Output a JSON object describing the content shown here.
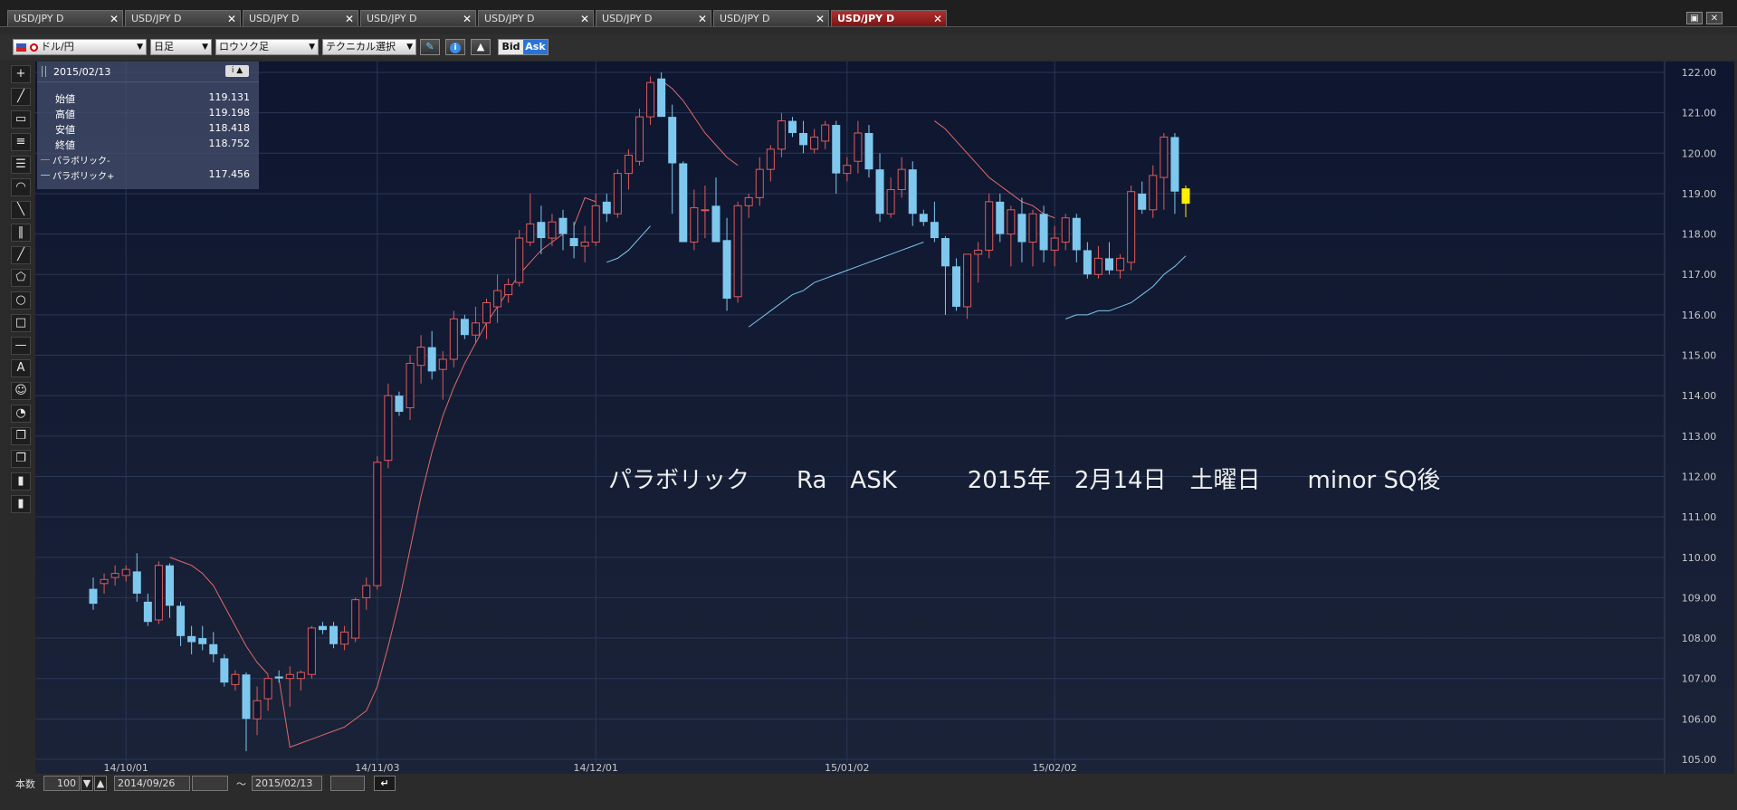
{
  "tabs": [
    {
      "label": "USD/JPY D",
      "active": false
    },
    {
      "label": "USD/JPY D",
      "active": false
    },
    {
      "label": "USD/JPY D",
      "active": false
    },
    {
      "label": "USD/JPY D",
      "active": false
    },
    {
      "label": "USD/JPY D",
      "active": false
    },
    {
      "label": "USD/JPY D",
      "active": false
    },
    {
      "label": "USD/JPY D",
      "active": false
    },
    {
      "label": "USD/JPY D",
      "active": true
    }
  ],
  "toolbar": {
    "currency_pair": "ドル/円",
    "timeframe": "日足",
    "chart_type": "ロウソク足",
    "technical_select": "テクニカル選択",
    "bid_label": "Bid",
    "ask_label": "Ask"
  },
  "info_panel": {
    "date": "2015/02/13",
    "rows": [
      {
        "label": "始値",
        "value": "119.131"
      },
      {
        "label": "高値",
        "value": "119.198"
      },
      {
        "label": "安値",
        "value": "118.418"
      },
      {
        "label": "終値",
        "value": "118.752"
      },
      {
        "label": "パラボリック-",
        "value": ""
      },
      {
        "label": "パラボリック+",
        "value": "117.456"
      }
    ]
  },
  "annotation": "パラボリック　　Ra　ASK　　　2015年　2月14日　土曜日　　minor SQ後",
  "bottom": {
    "count_label": "本数",
    "count_value": "100",
    "from_date": "2014/09/26",
    "separator": "～",
    "to_date": "2015/02/13"
  },
  "colors": {
    "background": "#101a33",
    "grid": "#2a3755",
    "up_candle": "#e05a5a",
    "down_candle": "#7ec8ee",
    "parabolic": "#e06a6a",
    "current_candle": "#ffee00",
    "active_tab": "#a02020"
  },
  "chart_data": {
    "type": "candlestick",
    "title": "",
    "ylim": [
      105,
      122
    ],
    "y_ticks": [
      "105.00",
      "106.00",
      "107.00",
      "108.00",
      "109.00",
      "110.00",
      "111.00",
      "112.00",
      "113.00",
      "114.00",
      "115.00",
      "116.00",
      "117.00",
      "118.00",
      "119.00",
      "120.00",
      "121.00",
      "122.00"
    ],
    "x_ticks": [
      {
        "label": "14/10/01",
        "index": 3
      },
      {
        "label": "14/11/03",
        "index": 26
      },
      {
        "label": "14/12/01",
        "index": 46
      },
      {
        "label": "15/01/02",
        "index": 69
      },
      {
        "label": "15/02/02",
        "index": 88
      }
    ],
    "candles": [
      [
        109.22,
        109.5,
        108.7,
        108.85
      ],
      [
        109.35,
        109.6,
        109.1,
        109.45
      ],
      [
        109.5,
        109.8,
        109.3,
        109.6
      ],
      [
        109.55,
        109.8,
        109.4,
        109.7
      ],
      [
        109.65,
        110.1,
        108.9,
        109.1
      ],
      [
        108.9,
        109.1,
        108.3,
        108.4
      ],
      [
        108.45,
        109.9,
        108.35,
        109.8
      ],
      [
        109.8,
        109.85,
        108.5,
        108.8
      ],
      [
        108.8,
        108.9,
        107.8,
        108.05
      ],
      [
        108.05,
        108.3,
        107.6,
        107.9
      ],
      [
        108.0,
        108.3,
        107.7,
        107.85
      ],
      [
        107.85,
        108.15,
        107.4,
        107.6
      ],
      [
        107.5,
        107.6,
        106.8,
        106.9
      ],
      [
        106.85,
        107.2,
        106.7,
        107.1
      ],
      [
        107.1,
        107.15,
        105.2,
        106.0
      ],
      [
        106.0,
        106.8,
        105.6,
        106.45
      ],
      [
        106.5,
        107.1,
        106.2,
        107.0
      ],
      [
        107.05,
        107.2,
        106.9,
        107.0
      ],
      [
        107.0,
        107.3,
        106.3,
        107.1
      ],
      [
        107.0,
        107.2,
        106.7,
        107.15
      ],
      [
        107.1,
        108.3,
        107.0,
        108.25
      ],
      [
        108.3,
        108.4,
        108.1,
        108.2
      ],
      [
        108.3,
        108.4,
        107.75,
        107.85
      ],
      [
        107.85,
        108.3,
        107.7,
        108.15
      ],
      [
        108.0,
        109.0,
        107.9,
        108.95
      ],
      [
        109.0,
        109.5,
        108.7,
        109.3
      ],
      [
        109.3,
        112.5,
        109.2,
        112.35
      ],
      [
        112.4,
        114.3,
        112.2,
        114.0
      ],
      [
        114.0,
        114.1,
        113.5,
        113.6
      ],
      [
        113.7,
        115.0,
        113.4,
        114.8
      ],
      [
        114.75,
        115.5,
        114.3,
        115.2
      ],
      [
        115.2,
        115.6,
        114.4,
        114.6
      ],
      [
        114.65,
        115.1,
        113.9,
        114.9
      ],
      [
        114.9,
        116.1,
        114.7,
        115.9
      ],
      [
        115.9,
        116.0,
        115.4,
        115.5
      ],
      [
        115.5,
        116.2,
        115.3,
        115.8
      ],
      [
        115.8,
        116.4,
        115.4,
        116.3
      ],
      [
        116.2,
        117.0,
        115.8,
        116.6
      ],
      [
        116.5,
        116.9,
        116.3,
        116.75
      ],
      [
        116.8,
        118.1,
        116.7,
        117.9
      ],
      [
        117.8,
        119.0,
        117.7,
        118.25
      ],
      [
        118.3,
        118.7,
        117.5,
        117.9
      ],
      [
        117.9,
        118.5,
        117.7,
        118.3
      ],
      [
        118.4,
        118.6,
        117.6,
        118.0
      ],
      [
        117.9,
        118.3,
        117.4,
        117.7
      ],
      [
        117.7,
        118.2,
        117.3,
        117.8
      ],
      [
        117.8,
        119.0,
        117.7,
        118.7
      ],
      [
        118.8,
        119.0,
        118.3,
        118.5
      ],
      [
        118.5,
        119.6,
        118.4,
        119.5
      ],
      [
        119.5,
        120.1,
        119.1,
        119.95
      ],
      [
        119.8,
        121.1,
        119.7,
        120.9
      ],
      [
        120.9,
        121.9,
        120.7,
        121.75
      ],
      [
        121.85,
        122.0,
        120.9,
        120.9
      ],
      [
        120.9,
        121.2,
        118.5,
        119.75
      ],
      [
        119.75,
        119.8,
        117.8,
        117.8
      ],
      [
        117.8,
        119.1,
        117.6,
        118.65
      ],
      [
        118.6,
        119.2,
        117.9,
        118.6
      ],
      [
        118.7,
        119.4,
        117.9,
        117.8
      ],
      [
        117.85,
        118.4,
        116.1,
        116.4
      ],
      [
        116.45,
        118.8,
        116.3,
        118.7
      ],
      [
        118.7,
        119.0,
        118.4,
        118.9
      ],
      [
        118.9,
        119.9,
        118.7,
        119.6
      ],
      [
        119.6,
        120.2,
        119.3,
        120.1
      ],
      [
        120.1,
        121.0,
        119.9,
        120.8
      ],
      [
        120.8,
        120.9,
        120.4,
        120.5
      ],
      [
        120.5,
        120.8,
        120.0,
        120.2
      ],
      [
        120.1,
        120.6,
        120.0,
        120.4
      ],
      [
        120.3,
        120.8,
        120.1,
        120.7
      ],
      [
        120.7,
        120.8,
        119.0,
        119.5
      ],
      [
        119.5,
        119.9,
        119.3,
        119.7
      ],
      [
        119.8,
        120.8,
        119.5,
        120.5
      ],
      [
        120.5,
        120.7,
        119.4,
        119.6
      ],
      [
        119.6,
        120.0,
        118.3,
        118.5
      ],
      [
        118.5,
        119.4,
        118.4,
        119.1
      ],
      [
        119.1,
        119.9,
        118.9,
        119.6
      ],
      [
        119.6,
        119.8,
        118.2,
        118.5
      ],
      [
        118.5,
        118.6,
        118.2,
        118.3
      ],
      [
        118.3,
        118.8,
        117.8,
        117.9
      ],
      [
        117.9,
        117.95,
        116.0,
        117.2
      ],
      [
        117.2,
        117.4,
        116.1,
        116.2
      ],
      [
        116.2,
        117.0,
        115.9,
        117.5
      ],
      [
        117.5,
        117.8,
        116.8,
        117.6
      ],
      [
        117.6,
        119.0,
        117.4,
        118.8
      ],
      [
        118.8,
        119.0,
        117.8,
        118.0
      ],
      [
        118.0,
        118.7,
        117.2,
        118.6
      ],
      [
        118.5,
        118.9,
        117.3,
        117.8
      ],
      [
        117.8,
        118.6,
        117.2,
        118.5
      ],
      [
        118.5,
        118.7,
        117.3,
        117.6
      ],
      [
        117.6,
        118.2,
        117.2,
        117.9
      ],
      [
        117.8,
        118.5,
        117.6,
        118.4
      ],
      [
        118.4,
        118.5,
        117.3,
        117.6
      ],
      [
        117.6,
        117.8,
        116.9,
        117.0
      ],
      [
        117.0,
        117.7,
        116.9,
        117.4
      ],
      [
        117.4,
        117.8,
        117.0,
        117.1
      ],
      [
        117.1,
        117.5,
        116.9,
        117.4
      ],
      [
        117.3,
        119.2,
        117.1,
        119.05
      ],
      [
        119.0,
        119.3,
        118.5,
        118.6
      ],
      [
        118.6,
        119.7,
        118.4,
        119.45
      ],
      [
        119.4,
        120.5,
        118.6,
        120.4
      ],
      [
        120.4,
        120.5,
        118.5,
        119.05
      ],
      [
        119.13,
        119.2,
        118.42,
        118.75
      ]
    ],
    "parabolic": [
      [
        4,
        108.5
      ],
      [
        5,
        108.6
      ],
      [
        6,
        108.8
      ],
      [
        7,
        110.0
      ],
      [
        8,
        109.9
      ],
      [
        9,
        109.8
      ],
      [
        10,
        109.6
      ],
      [
        11,
        109.3
      ],
      [
        12,
        108.8
      ],
      [
        13,
        108.3
      ],
      [
        14,
        107.8
      ],
      [
        15,
        107.4
      ],
      [
        16,
        107.1
      ],
      [
        17,
        107.0
      ],
      [
        18,
        105.3
      ],
      [
        19,
        105.4
      ],
      [
        20,
        105.5
      ],
      [
        21,
        105.6
      ],
      [
        22,
        105.7
      ],
      [
        23,
        105.8
      ],
      [
        24,
        106.0
      ],
      [
        25,
        106.2
      ],
      [
        26,
        106.8
      ],
      [
        27,
        107.8
      ],
      [
        28,
        108.9
      ],
      [
        29,
        110.2
      ],
      [
        30,
        111.5
      ],
      [
        31,
        112.6
      ],
      [
        32,
        113.5
      ],
      [
        33,
        114.2
      ],
      [
        34,
        114.8
      ],
      [
        35,
        115.3
      ],
      [
        36,
        115.8
      ],
      [
        37,
        116.2
      ],
      [
        38,
        116.6
      ],
      [
        39,
        117.0
      ],
      [
        40,
        117.3
      ],
      [
        41,
        117.6
      ],
      [
        42,
        117.8
      ],
      [
        43,
        118.0
      ],
      [
        44,
        118.2
      ],
      [
        45,
        118.9
      ],
      [
        46,
        118.8
      ],
      [
        47,
        117.3
      ],
      [
        48,
        117.4
      ],
      [
        49,
        117.6
      ],
      [
        50,
        117.9
      ],
      [
        51,
        118.2
      ],
      [
        52,
        121.8
      ],
      [
        53,
        121.6
      ],
      [
        54,
        121.3
      ],
      [
        55,
        120.9
      ],
      [
        56,
        120.5
      ],
      [
        57,
        120.2
      ],
      [
        58,
        119.9
      ],
      [
        59,
        119.7
      ],
      [
        60,
        115.7
      ],
      [
        61,
        115.9
      ],
      [
        62,
        116.1
      ],
      [
        63,
        116.3
      ],
      [
        64,
        116.5
      ],
      [
        65,
        116.6
      ],
      [
        66,
        116.8
      ],
      [
        67,
        116.9
      ],
      [
        68,
        117.0
      ],
      [
        69,
        117.1
      ],
      [
        70,
        117.2
      ],
      [
        71,
        117.3
      ],
      [
        72,
        117.4
      ],
      [
        73,
        117.5
      ],
      [
        74,
        117.6
      ],
      [
        75,
        117.7
      ],
      [
        76,
        117.8
      ],
      [
        77,
        120.8
      ],
      [
        78,
        120.6
      ],
      [
        79,
        120.3
      ],
      [
        80,
        120.0
      ],
      [
        81,
        119.7
      ],
      [
        82,
        119.4
      ],
      [
        83,
        119.2
      ],
      [
        84,
        119.0
      ],
      [
        85,
        118.8
      ],
      [
        86,
        118.7
      ],
      [
        87,
        118.5
      ],
      [
        88,
        118.4
      ],
      [
        89,
        115.9
      ],
      [
        90,
        116.0
      ],
      [
        91,
        116.0
      ],
      [
        92,
        116.1
      ],
      [
        93,
        116.1
      ],
      [
        94,
        116.2
      ],
      [
        95,
        116.3
      ],
      [
        96,
        116.5
      ],
      [
        97,
        116.7
      ],
      [
        98,
        117.0
      ],
      [
        99,
        117.2
      ],
      [
        100,
        117.46
      ]
    ]
  }
}
